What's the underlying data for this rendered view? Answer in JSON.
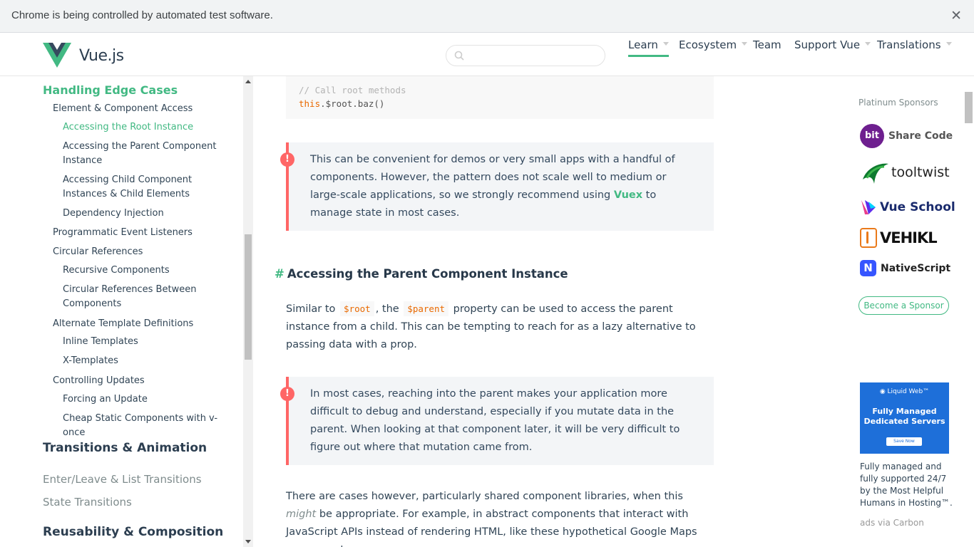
{
  "infobar": {
    "message": "Chrome is being controlled by automated test software.",
    "close_glyph": "✕"
  },
  "header": {
    "logo_text": "Vue.js",
    "logo_color": "#42b983",
    "search_placeholder": "",
    "nav": [
      {
        "label": "Learn",
        "dropdown": true,
        "active": true
      },
      {
        "label": "Ecosystem",
        "dropdown": true,
        "active": false
      },
      {
        "label": "Team",
        "dropdown": false,
        "active": false
      },
      {
        "label": "Support Vue",
        "dropdown": true,
        "active": false
      },
      {
        "label": "Translations",
        "dropdown": true,
        "active": false
      }
    ]
  },
  "sidebar": {
    "section_title": "Handling Edge Cases",
    "items": [
      {
        "level": 1,
        "label": "Element & Component Access"
      },
      {
        "level": 2,
        "label": "Accessing the Root Instance",
        "active": true
      },
      {
        "level": 2,
        "label": "Accessing the Parent Component Instance"
      },
      {
        "level": 2,
        "label": "Accessing Child Component Instances & Child Elements"
      },
      {
        "level": 2,
        "label": "Dependency Injection"
      },
      {
        "level": 1,
        "label": "Programmatic Event Listeners"
      },
      {
        "level": 1,
        "label": "Circular References"
      },
      {
        "level": 2,
        "label": "Recursive Components"
      },
      {
        "level": 2,
        "label": "Circular References Between Components"
      },
      {
        "level": 1,
        "label": "Alternate Template Definitions"
      },
      {
        "level": 2,
        "label": "Inline Templates"
      },
      {
        "level": 2,
        "label": "X-Templates"
      },
      {
        "level": 1,
        "label": "Controlling Updates"
      },
      {
        "level": 2,
        "label": "Forcing an Update"
      },
      {
        "level": 2,
        "label": "Cheap Static Components with v-once"
      }
    ],
    "section2_title": "Transitions & Animation",
    "section2_items": [
      "Enter/Leave & List Transitions",
      "State Transitions"
    ],
    "section3_title": "Reusability & Composition"
  },
  "main": {
    "code_comment": "// Call root methods",
    "code_keyword": "this",
    "code_rest": ".$root.baz()",
    "tip1_before": "This can be convenient for demos or very small apps with a handful of components. However, the pattern does not scale well to medium or large-scale applications, so we strongly recommend using ",
    "tip1_link": "Vuex",
    "tip1_after": " to manage state in most cases.",
    "tip_icon": "!",
    "heading_hash": "#",
    "heading": "Accessing the Parent Component Instance",
    "para1_a": "Similar to ",
    "para1_code1": "$root",
    "para1_b": ", the ",
    "para1_code2": "$parent",
    "para1_c": " property can be used to access the parent instance from a child. This can be tempting to reach for as a lazy alternative to passing data with a prop.",
    "tip2": "In most cases, reaching into the parent makes your application more difficult to debug and understand, especially if you mutate data in the parent. When looking at that component later, it will be very difficult to figure out where that mutation came from.",
    "para2_a": "There are cases however, particularly shared component libraries, when this ",
    "para2_em": "might",
    "para2_b": " be appropriate. For example, in abstract components that interact with JavaScript APIs instead of rendering HTML, like these hypothetical Google Maps components:"
  },
  "right": {
    "sponsor_title": "Platinum Sponsors",
    "sponsors": [
      {
        "name": "Share Code",
        "icon": "bit-logo",
        "badge": "bit",
        "color": "#6e1f8f"
      },
      {
        "name": "tooltwist",
        "icon": "tooltwist-logo",
        "color": "#0e7a2f"
      },
      {
        "name": "Vue School",
        "icon": "vueschool-logo",
        "color": "#1a2b6d"
      },
      {
        "name": "VEHIKL",
        "icon": "vehikl-logo",
        "color": "#ea7a1a"
      },
      {
        "name": "NativeScript",
        "icon": "nativescript-logo",
        "badge": "N",
        "color": "#3655ff"
      }
    ],
    "become_sponsor": "Become a Sponsor",
    "ad_brand": "◉ Liquid Web™",
    "ad_headline": "Fully Managed Dedicated Servers",
    "ad_button": "Save Now",
    "ad_description": "Fully managed and fully supported 24/7 by the Most Helpful Humans in Hosting™.",
    "ad_via": "ads via Carbon"
  }
}
